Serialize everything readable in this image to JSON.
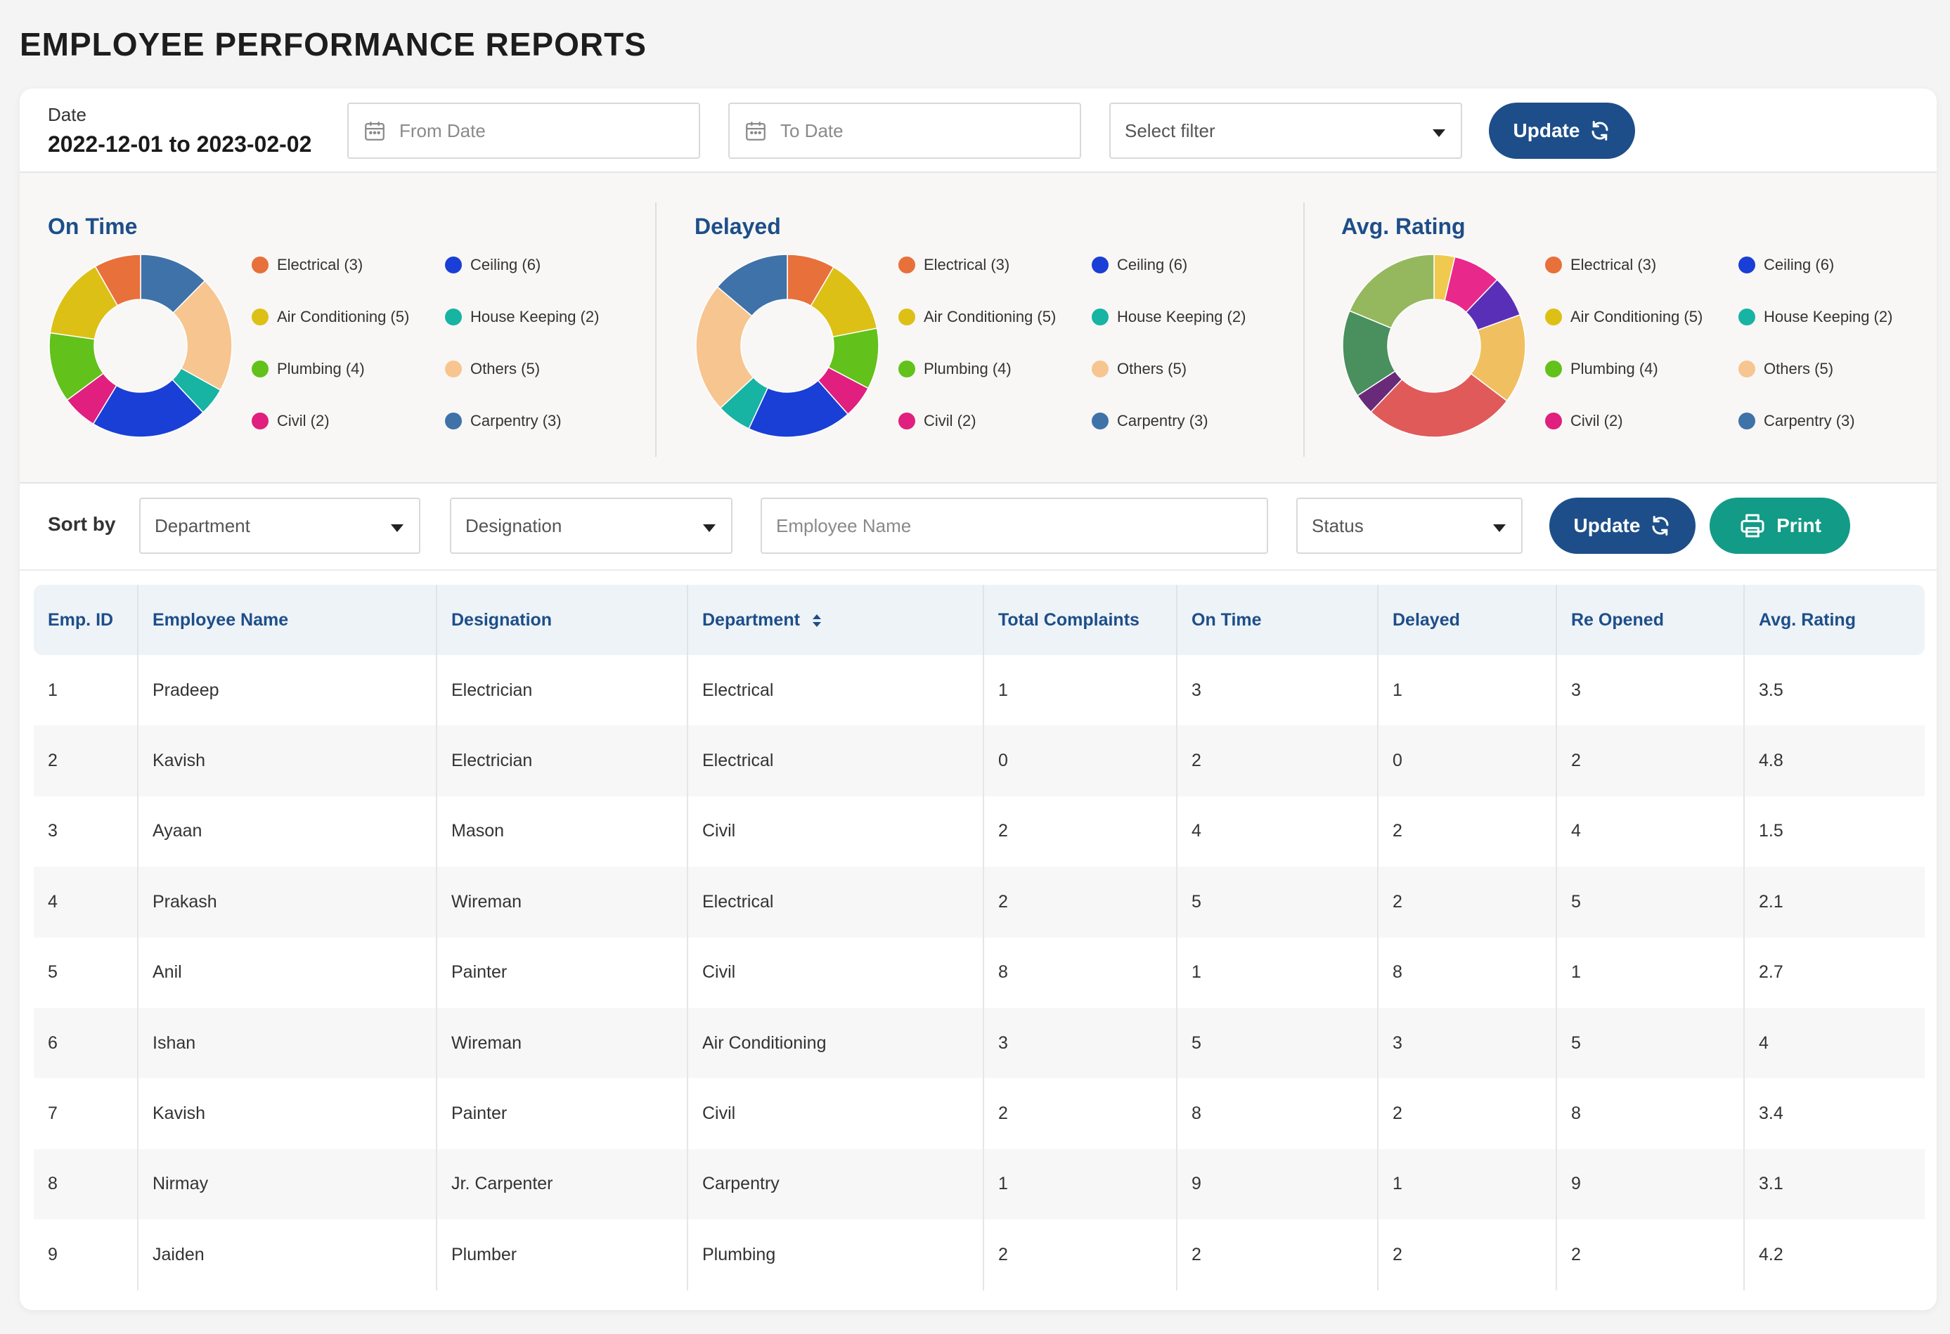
{
  "page": {
    "title": "EMPLOYEE PERFORMANCE REPORTS"
  },
  "filters": {
    "date_label": "Date",
    "date_range": "2022-12-01 to 2023-02-02",
    "from_placeholder": "From Date",
    "to_placeholder": "To Date",
    "select_filter": "Select filter",
    "update_label": "Update"
  },
  "colors": {
    "primary": "#1d4e89",
    "print": "#129b86",
    "electrical": "#e8703a",
    "ceiling": "#1a3fd6",
    "air_conditioning": "#ddc016",
    "house_keeping": "#17b3a3",
    "plumbing": "#62c11a",
    "others": "#f7c590",
    "civil": "#e01f7e",
    "carpentry": "#3f72a8"
  },
  "charts": {
    "on_time": {
      "title": "On Time",
      "legend": [
        "Electrical (3)",
        "Ceiling (6)",
        "Air Conditioning (5)",
        "House Keeping (2)",
        "Plumbing (4)",
        "Others (5)",
        "Civil (2)",
        "Carpentry (3)"
      ]
    },
    "delayed": {
      "title": "Delayed",
      "legend": [
        "Electrical (3)",
        "Ceiling (6)",
        "Air Conditioning (5)",
        "House Keeping (2)",
        "Plumbing (4)",
        "Others (5)",
        "Civil (2)",
        "Carpentry (3)"
      ]
    },
    "avg_rating": {
      "title": "Avg. Rating",
      "legend": [
        "Electrical (3)",
        "Ceiling (6)",
        "Air Conditioning (5)",
        "House Keeping (2)",
        "Plumbing (4)",
        "Others (5)",
        "Civil (2)",
        "Carpentry (3)"
      ]
    }
  },
  "chart_data": [
    {
      "type": "pie",
      "title": "On Time",
      "categories": [
        "Ceiling",
        "Others",
        "House Keeping",
        "Ceiling",
        "Civil",
        "Plumbing",
        "Air Conditioning",
        "Electrical"
      ],
      "values": [
        3,
        5,
        1.2,
        5,
        1.5,
        3,
        3.5,
        2
      ],
      "colors": [
        "#3f72a8",
        "#f7c590",
        "#17b3a3",
        "#1a3fd6",
        "#e01f7e",
        "#62c11a",
        "#ddc016",
        "#e8703a"
      ]
    },
    {
      "type": "pie",
      "title": "Delayed",
      "categories": [
        "Electrical",
        "Air Conditioning",
        "Plumbing",
        "Civil",
        "Ceiling",
        "House Keeping",
        "Others",
        "Carpentry"
      ],
      "values": [
        2.2,
        3.5,
        2.8,
        1.5,
        4.8,
        1.6,
        6,
        3.6
      ],
      "colors": [
        "#e8703a",
        "#ddc016",
        "#62c11a",
        "#e01f7e",
        "#1a3fd6",
        "#17b3a3",
        "#f7c590",
        "#3f72a8"
      ]
    },
    {
      "type": "pie",
      "title": "Avg. Rating",
      "categories": [
        "",
        "",
        "",
        "",
        "",
        "",
        "",
        ""
      ],
      "values": [
        1,
        2.3,
        2,
        4.3,
        7.3,
        1,
        4.2,
        5.1
      ],
      "colors": [
        "#f0c94f",
        "#e8288a",
        "#5a2fb8",
        "#f0c060",
        "#e05a5a",
        "#6a2a7a",
        "#4a8f5e",
        "#95b85e"
      ]
    }
  ],
  "sortbar": {
    "sort_label": "Sort by",
    "department": "Department",
    "designation": "Designation",
    "employee_placeholder": "Employee Name",
    "status": "Status",
    "update_label": "Update",
    "print_label": "Print"
  },
  "table": {
    "headers": [
      "Emp. ID",
      "Employee Name",
      "Designation",
      "Department",
      "Total Complaints",
      "On Time",
      "Delayed",
      "Re Opened",
      "Avg. Rating"
    ],
    "rows": [
      [
        "1",
        "Pradeep",
        "Electrician",
        "Electrical",
        "1",
        "3",
        "1",
        "3",
        "3.5"
      ],
      [
        "2",
        "Kavish",
        "Electrician",
        "Electrical",
        "0",
        "2",
        "0",
        "2",
        "4.8"
      ],
      [
        "3",
        "Ayaan",
        "Mason",
        "Civil",
        "2",
        "4",
        "2",
        "4",
        "1.5"
      ],
      [
        "4",
        "Prakash",
        "Wireman",
        "Electrical",
        "2",
        "5",
        "2",
        "5",
        "2.1"
      ],
      [
        "5",
        "Anil",
        "Painter",
        "Civil",
        "8",
        "1",
        "8",
        "1",
        "2.7"
      ],
      [
        "6",
        "Ishan",
        "Wireman",
        "Air Conditioning",
        "3",
        "5",
        "3",
        "5",
        "4"
      ],
      [
        "7",
        "Kavish",
        "Painter",
        "Civil",
        "2",
        "8",
        "2",
        "8",
        "3.4"
      ],
      [
        "8",
        "Nirmay",
        "Jr. Carpenter",
        "Carpentry",
        "1",
        "9",
        "1",
        "9",
        "3.1"
      ],
      [
        "9",
        "Jaiden",
        "Plumber",
        "Plumbing",
        "2",
        "2",
        "2",
        "2",
        "4.2"
      ]
    ]
  }
}
